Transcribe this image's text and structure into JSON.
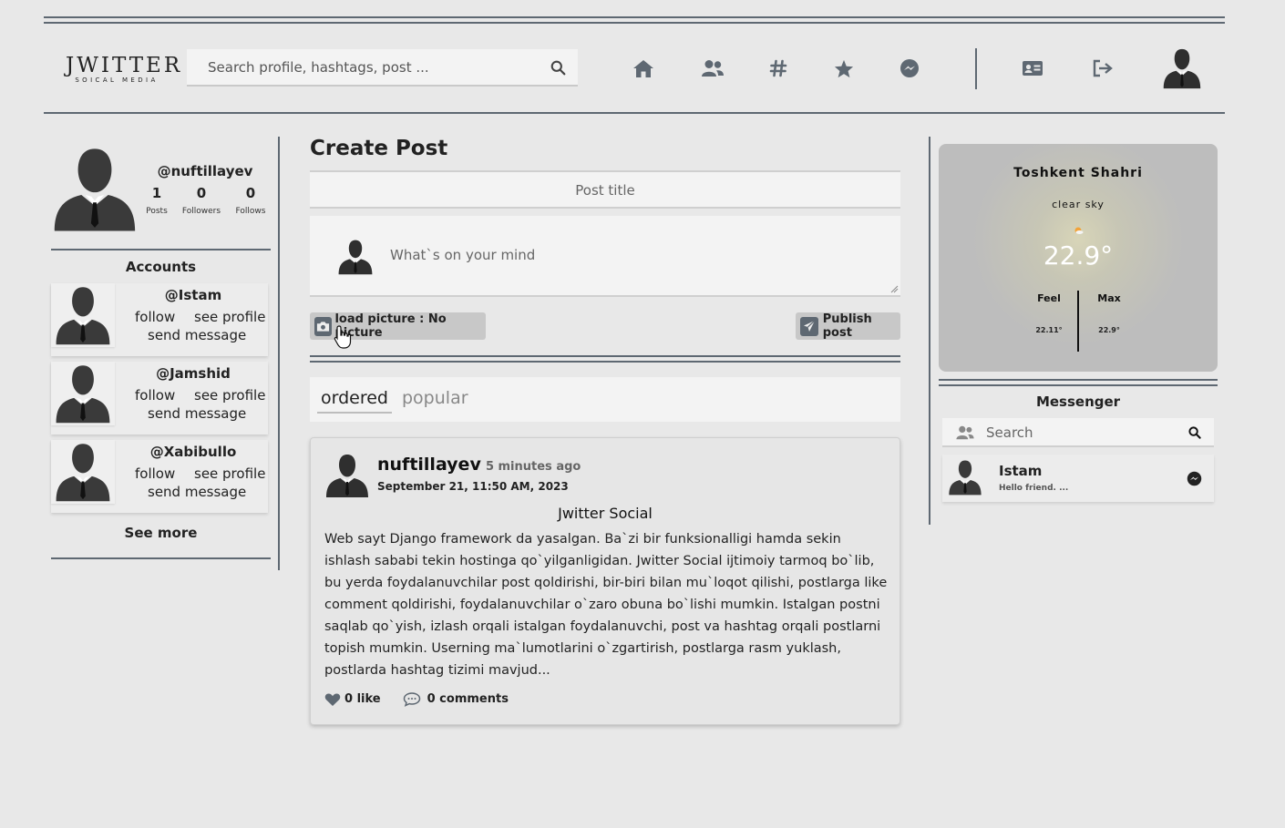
{
  "header": {
    "logo_title": "JWITTER",
    "logo_subtitle": "SOICAL MEDIA",
    "search_placeholder": "Search profile, hashtags, post ...",
    "nav_icons": [
      "home-icon",
      "users-icon",
      "hashtag-icon",
      "star-icon",
      "messenger-icon",
      "id-card-icon",
      "logout-icon"
    ]
  },
  "profile": {
    "handle": "@nuftillayev",
    "stats": [
      {
        "value": "1",
        "label": "Posts"
      },
      {
        "value": "0",
        "label": "Followers"
      },
      {
        "value": "0",
        "label": "Follows"
      }
    ]
  },
  "accounts": {
    "title": "Accounts",
    "items": [
      {
        "handle": "@Istam",
        "follow": "follow",
        "see_profile": "see profile",
        "send_message": "send message"
      },
      {
        "handle": "@Jamshid",
        "follow": "follow",
        "see_profile": "see profile",
        "send_message": "send message"
      },
      {
        "handle": "@Xabibullo",
        "follow": "follow",
        "see_profile": "see profile",
        "send_message": "send message"
      }
    ],
    "see_more": "See more"
  },
  "create_post": {
    "title": "Create Post",
    "title_placeholder": "Post title",
    "body_placeholder": "What`s on your mind",
    "upload_label": "load picture : No picture",
    "publish_label": "Publish post"
  },
  "tabs": {
    "ordered": "ordered",
    "popular": "popular",
    "active": "ordered"
  },
  "post": {
    "author": "nuftillayev",
    "time_ago": "5 minutes ago",
    "date": "September 21, 11:50 AM, 2023",
    "title": "Jwitter Social",
    "body": "Web sayt Django framework da yasalgan. Ba`zi bir funksionalligi hamda sekin ishlash sababi tekin hostinga qo`yilganligidan. Jwitter Social ijtimoiy tarmoq bo`lib, bu yerda foydalanuvchilar post qoldirishi, bir-biri bilan mu`loqot qilishi, postlarga like comment qoldirishi, foydalanuvchilar o`zaro obuna bo`lishi mumkin. Istalgan postni saqlab qo`yish, izlash orqali istalgan foydalanuvchi, post va hashtag orqali postlarni topish mumkin. Userning ma`lumotlarini o`zgartirish, postlarga rasm yuklash, postlarda hashtag tizimi mavjud...",
    "likes": "0 like",
    "comments": "0 comments"
  },
  "weather": {
    "city": "Toshkent Shahri",
    "condition": "clear sky",
    "temp": "22.9°",
    "feel_label": "Feel",
    "feel_value": "22.11°",
    "max_label": "Max",
    "max_value": "22.9°"
  },
  "messenger": {
    "title": "Messenger",
    "search_placeholder": "Search",
    "chats": [
      {
        "name": "Istam",
        "preview": "Hello friend. ..."
      }
    ]
  },
  "colors": {
    "background": "#e8e8e8",
    "divider": "#5e6872",
    "field": "#f3f3f3",
    "button": "#c8c8c8"
  }
}
